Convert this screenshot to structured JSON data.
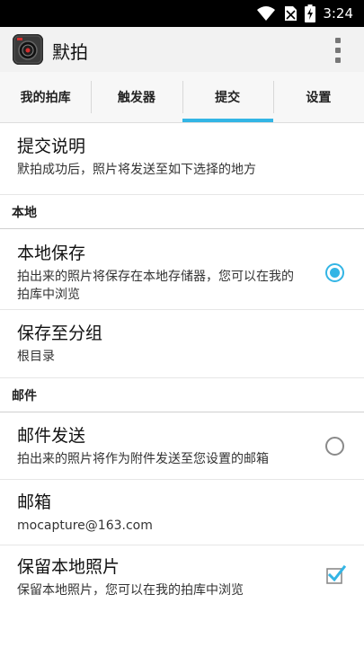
{
  "status_bar": {
    "time": "3:24"
  },
  "app": {
    "title": "默拍"
  },
  "tabs": [
    {
      "label": "我的拍库",
      "active": false
    },
    {
      "label": "触发器",
      "active": false
    },
    {
      "label": "提交",
      "active": true
    },
    {
      "label": "设置",
      "active": false
    }
  ],
  "prefs": {
    "submit_info": {
      "title": "提交说明",
      "summary": "默拍成功后，照片将发送至如下选择的地方"
    },
    "local_section": "本地",
    "local_save": {
      "title": "本地保存",
      "summary": "拍出来的照片将保存在本地存储器，您可以在我的拍库中浏览",
      "selected": true
    },
    "save_group": {
      "title": "保存至分组",
      "value": "根目录"
    },
    "mail_section": "邮件",
    "mail_send": {
      "title": "邮件发送",
      "summary": "拍出来的照片将作为附件发送至您设置的邮箱",
      "selected": false
    },
    "mailbox": {
      "title": "邮箱",
      "value": "mocapture@163.com"
    },
    "keep_local": {
      "title": "保留本地照片",
      "summary": "保留本地照片，您可以在我的拍库中浏览",
      "checked": true
    }
  },
  "colors": {
    "accent": "#33b5e5",
    "app_bar": "#f2f2f2",
    "status_bar": "#000000"
  }
}
